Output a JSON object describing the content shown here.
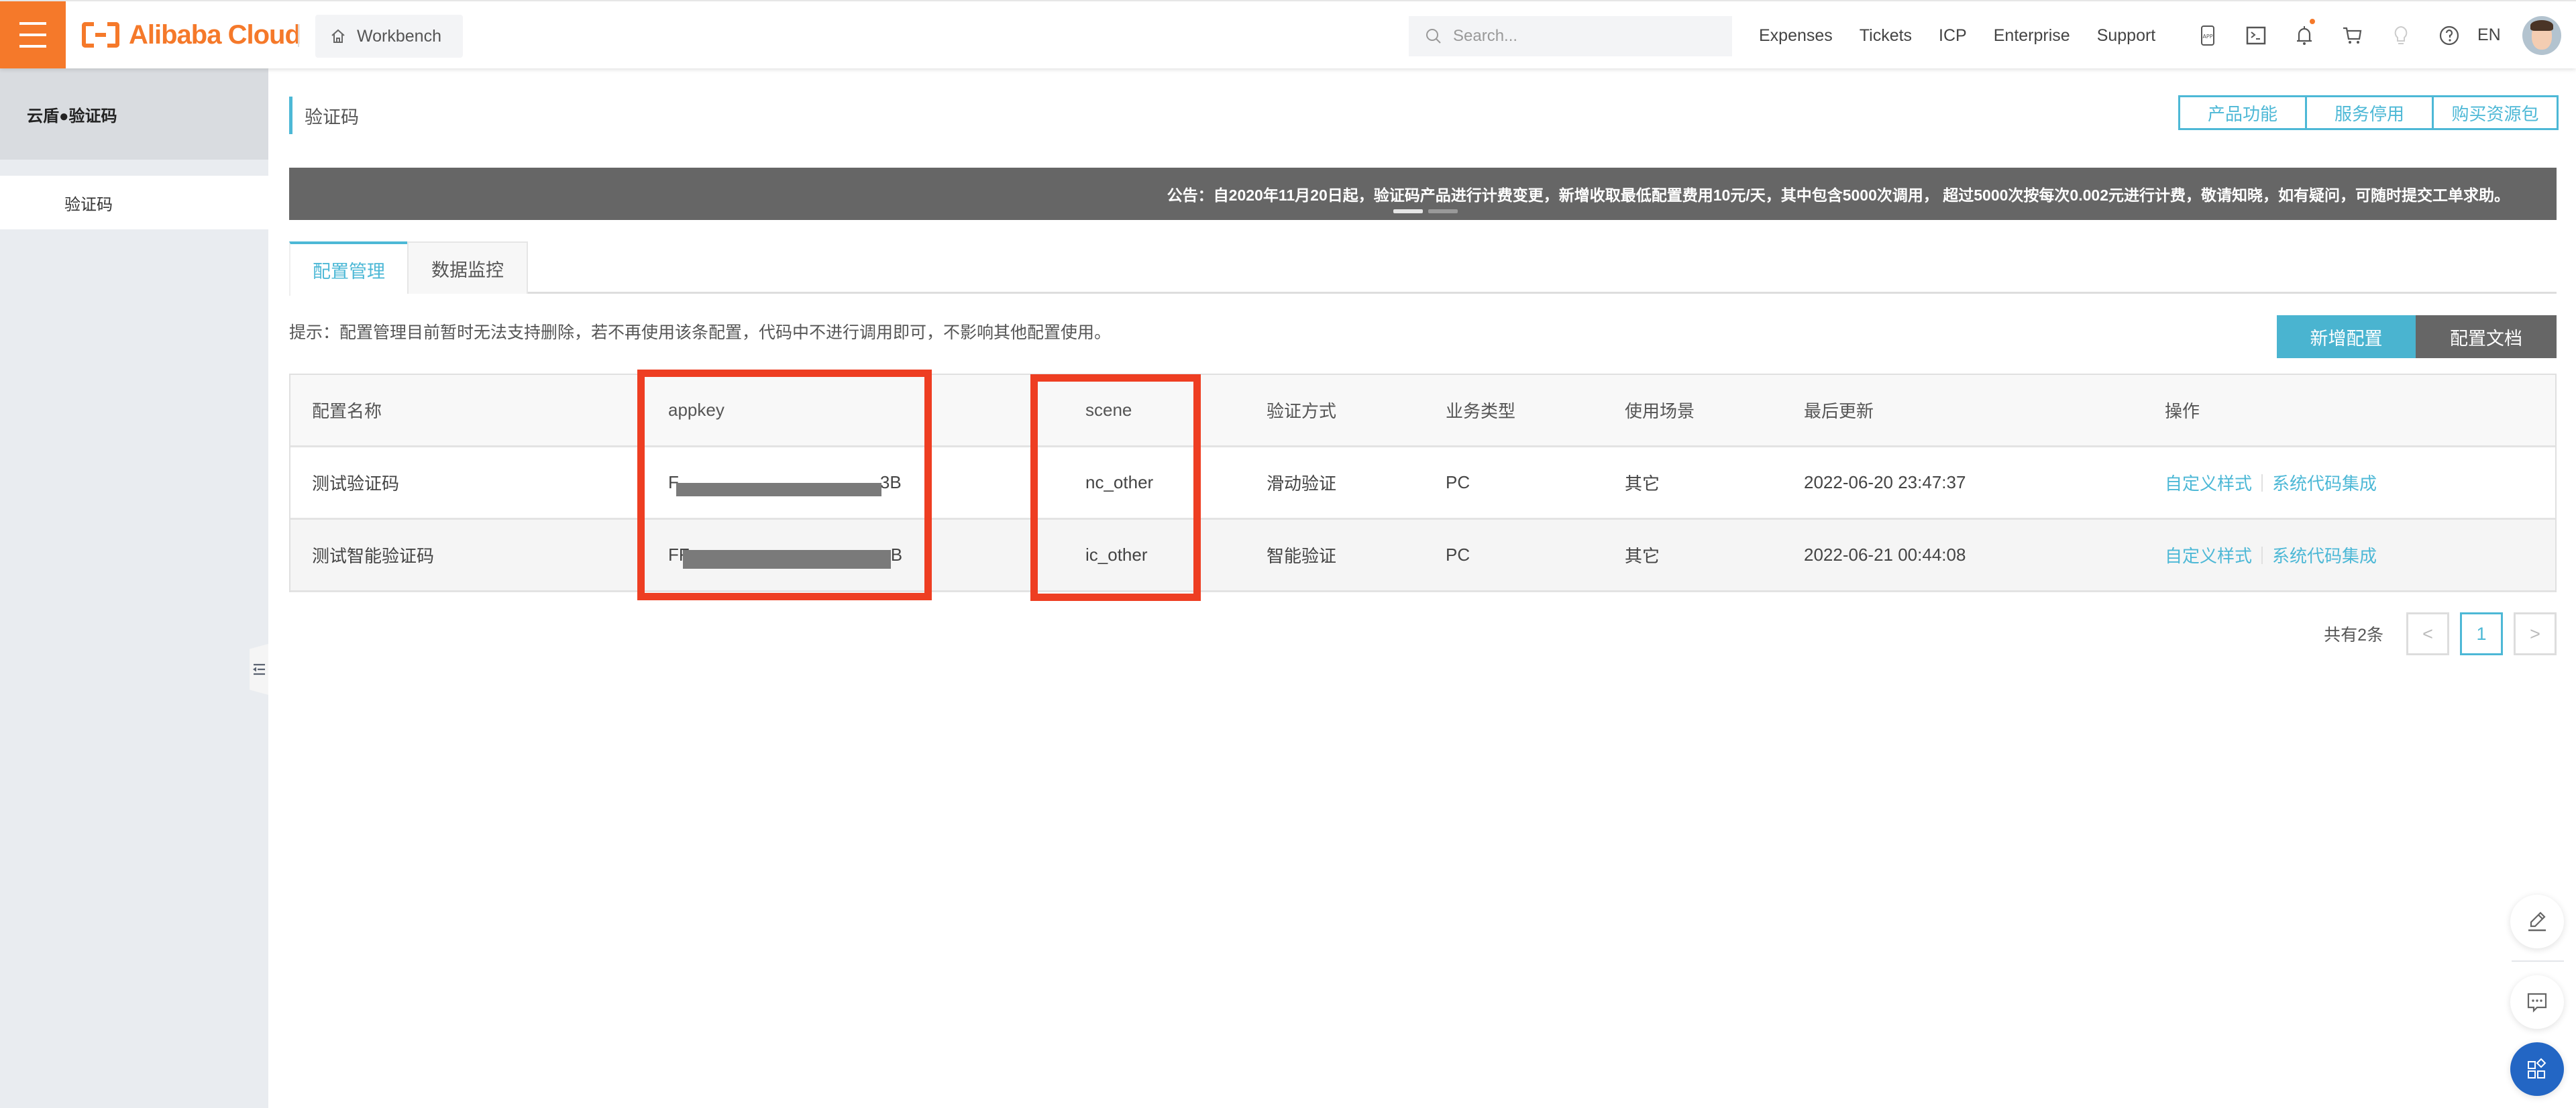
{
  "header": {
    "brand": "Alibaba Cloud",
    "workbench": "Workbench",
    "search_placeholder": "Search...",
    "nav": [
      "Expenses",
      "Tickets",
      "ICP",
      "Enterprise",
      "Support"
    ],
    "icons": [
      "app-icon",
      "terminal-icon",
      "bell-icon",
      "cart-icon",
      "lightbulb-icon",
      "help-icon"
    ],
    "lang": "EN",
    "accent": "#f5792a"
  },
  "sidebar": {
    "title": "云盾●验证码",
    "items": [
      {
        "label": "验证码",
        "active": true
      }
    ]
  },
  "page": {
    "title": "验证码",
    "actions": [
      "产品功能",
      "服务停用",
      "购买资源包"
    ],
    "accent": "#4db8d6"
  },
  "banner": {
    "text": "公告：自2020年11月20日起，验证码产品进行计费变更，新增收取最低配置费用10元/天，其中包含5000次调用， 超过5000次按每次0.002元进行计费，敬请知晓，如有疑问，可随时提交工单求助。",
    "slides": 2,
    "active_slide": 1
  },
  "tabs": [
    {
      "label": "配置管理",
      "active": true
    },
    {
      "label": "数据监控",
      "active": false
    }
  ],
  "hint": "提示：配置管理目前暂时无法支持删除，若不再使用该条配置，代码中不进行调用即可，不影响其他配置使用。",
  "buttons": {
    "add": "新增配置",
    "doc": "配置文档"
  },
  "table": {
    "columns": [
      "配置名称",
      "appkey",
      "scene",
      "验证方式",
      "业务类型",
      "使用场景",
      "最后更新",
      "操作"
    ],
    "rows": [
      {
        "name": "测试验证码",
        "appkey_prefix": "F",
        "appkey_suffix": "3B",
        "scene": "nc_other",
        "method": "滑动验证",
        "biz": "PC",
        "usage": "其它",
        "updated": "2022-06-20 23:47:37",
        "ops": [
          "自定义样式",
          "系统代码集成"
        ]
      },
      {
        "name": "测试智能验证码",
        "appkey_prefix": "FF",
        "appkey_suffix": "B",
        "scene": "ic_other",
        "method": "智能验证",
        "biz": "PC",
        "usage": "其它",
        "updated": "2022-06-21 00:44:08",
        "ops": [
          "自定义样式",
          "系统代码集成"
        ]
      }
    ],
    "highlight_columns": [
      "appkey",
      "scene"
    ],
    "highlight_color": "#ee3e22"
  },
  "pagination": {
    "total_label": "共有2条",
    "current_page": "1",
    "prev": "<",
    "next": ">"
  },
  "floating": [
    "edit-icon",
    "chat-icon",
    "apps-icon"
  ]
}
